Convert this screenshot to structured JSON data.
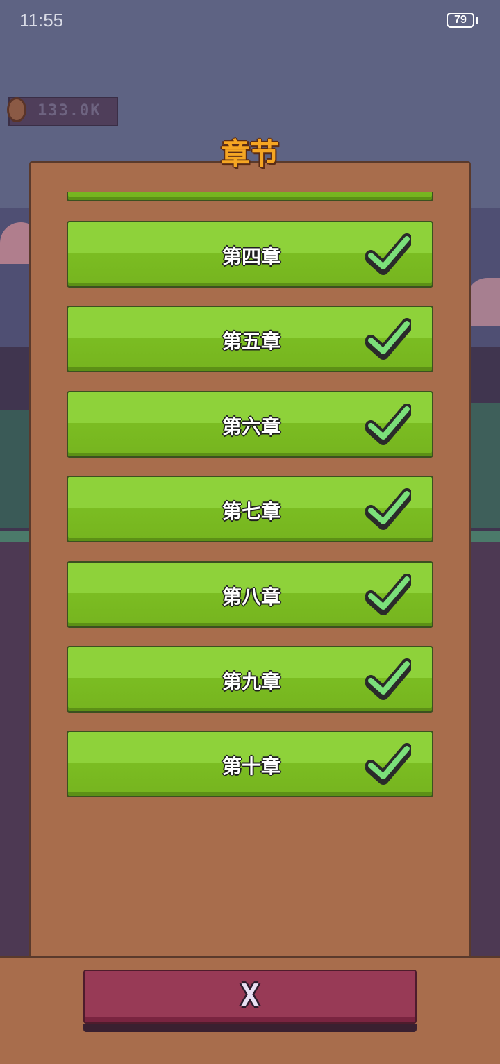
{
  "status_bar": {
    "time": "11:55",
    "battery": "79"
  },
  "coins": {
    "value": "133.0K"
  },
  "panel": {
    "title": "章节"
  },
  "chapters": [
    {
      "label": "",
      "completed": true
    },
    {
      "label": "第四章",
      "completed": true
    },
    {
      "label": "第五章",
      "completed": true
    },
    {
      "label": "第六章",
      "completed": true
    },
    {
      "label": "第七章",
      "completed": true
    },
    {
      "label": "第八章",
      "completed": true
    },
    {
      "label": "第九章",
      "completed": true
    },
    {
      "label": "第十章",
      "completed": true
    }
  ],
  "close_button": {
    "label": "X"
  },
  "colors": {
    "accent_title": "#f5a623",
    "chapter_green": "#8ed23a",
    "check_green": "#7be07a",
    "close_red": "#983a56",
    "panel_brown": "#a86d4c"
  }
}
